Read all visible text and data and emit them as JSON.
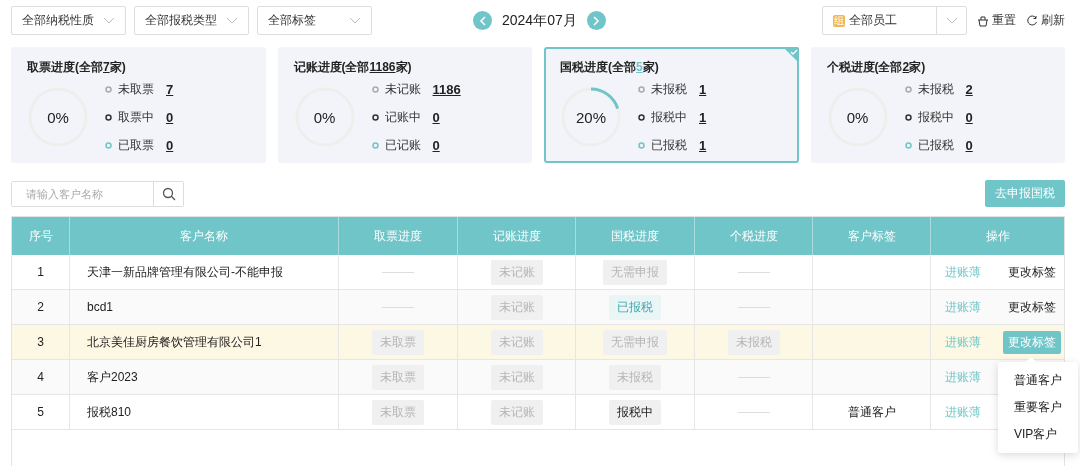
{
  "filters": [
    {
      "label": "全部纳税性质"
    },
    {
      "label": "全部报税类型"
    },
    {
      "label": "全部标签"
    }
  ],
  "month": {
    "label": "2024年07月"
  },
  "employee_select": {
    "badge": "组",
    "label": "全部员工"
  },
  "tools": [
    {
      "kind": "reset",
      "label": "重置"
    },
    {
      "kind": "refresh",
      "label": "刷新"
    }
  ],
  "cards": [
    {
      "title": "取票进度(全部",
      "total": "7",
      "title_end": "家)",
      "percent": "0%",
      "level": 0,
      "selected": false,
      "stats": [
        {
          "kind": "pending",
          "label": "未取票",
          "value": "7"
        },
        {
          "kind": "in_progress",
          "label": "取票中",
          "value": "0"
        },
        {
          "kind": "done",
          "label": "已取票",
          "value": "0"
        }
      ]
    },
    {
      "title": "记账进度(全部",
      "total": "1186",
      "title_end": "家)",
      "percent": "0%",
      "level": 0,
      "selected": false,
      "stats": [
        {
          "kind": "pending",
          "label": "未记账",
          "value": "1186"
        },
        {
          "kind": "in_progress",
          "label": "记账中",
          "value": "0"
        },
        {
          "kind": "done",
          "label": "已记账",
          "value": "0"
        }
      ]
    },
    {
      "title": "国税进度(全部",
      "total": "5",
      "title_end": "家)",
      "percent": "20%",
      "level": 0.2,
      "selected": true,
      "stats": [
        {
          "kind": "pending",
          "label": "未报税",
          "value": "1"
        },
        {
          "kind": "in_progress",
          "label": "报税中",
          "value": "1"
        },
        {
          "kind": "done",
          "label": "已报税",
          "value": "1"
        }
      ]
    },
    {
      "title": "个税进度(全部",
      "total": "2",
      "title_end": "家)",
      "percent": "0%",
      "level": 0,
      "selected": false,
      "stats": [
        {
          "kind": "pending",
          "label": "未报税",
          "value": "2"
        },
        {
          "kind": "in_progress",
          "label": "报税中",
          "value": "0"
        },
        {
          "kind": "done",
          "label": "已报税",
          "value": "0"
        }
      ]
    }
  ],
  "search": {
    "placeholder": "请输入客户名称"
  },
  "primary_button": "去申报国税",
  "table": {
    "columns": [
      "序号",
      "客户名称",
      "取票进度",
      "记账进度",
      "国税进度",
      "个税进度",
      "客户标签",
      "操作"
    ],
    "rows": [
      {
        "index": "1",
        "name": "天津一新品牌管理有限公司-不能申报",
        "selected": false,
        "progress": [
          {
            "kind": "none"
          },
          {
            "kind": "pending",
            "label": "未记账"
          },
          {
            "kind": "pending",
            "label": "无需申报"
          },
          {
            "kind": "none"
          }
        ],
        "actions": [
          {
            "kind": "link",
            "label": "进账薄"
          },
          {
            "kind": "button",
            "label": "更改标签",
            "active": false
          }
        ]
      },
      {
        "index": "2",
        "name": "bcd1",
        "selected": false,
        "progress": [
          {
            "kind": "none"
          },
          {
            "kind": "pending",
            "label": "未记账"
          },
          {
            "kind": "done",
            "label": "已报税"
          },
          {
            "kind": "none"
          }
        ],
        "actions": [
          {
            "kind": "link",
            "label": "进账薄"
          },
          {
            "kind": "button",
            "label": "更改标签",
            "active": false
          }
        ]
      },
      {
        "index": "3",
        "name": "北京美佳厨房餐饮管理有限公司1",
        "selected": true,
        "progress": [
          {
            "kind": "pending",
            "label": "未取票"
          },
          {
            "kind": "pending",
            "label": "未记账"
          },
          {
            "kind": "pending",
            "label": "无需申报"
          },
          {
            "kind": "pending",
            "label": "未报税"
          }
        ],
        "actions": [
          {
            "kind": "link",
            "label": "进账薄"
          },
          {
            "kind": "button",
            "label": "更改标签",
            "active": true
          }
        ]
      },
      {
        "index": "4",
        "name": "客户2023",
        "selected": false,
        "progress": [
          {
            "kind": "pending",
            "label": "未取票"
          },
          {
            "kind": "pending",
            "label": "未记账"
          },
          {
            "kind": "pending",
            "label": "未报税"
          },
          {
            "kind": "none"
          }
        ],
        "actions": [
          {
            "kind": "link",
            "label": "进账薄"
          }
        ]
      },
      {
        "index": "5",
        "name": "报税810",
        "selected": false,
        "progress": [
          {
            "kind": "pending",
            "label": "未取票"
          },
          {
            "kind": "pending",
            "label": "未记账"
          },
          {
            "kind": "in_progress",
            "label": "报税中"
          },
          {
            "kind": "none"
          }
        ],
        "tag": "普通客户",
        "actions": [
          {
            "kind": "link",
            "label": "进账薄"
          }
        ]
      }
    ]
  },
  "tag_menu": {
    "items": [
      "普通客户",
      "重要客户",
      "VIP客户"
    ]
  }
}
